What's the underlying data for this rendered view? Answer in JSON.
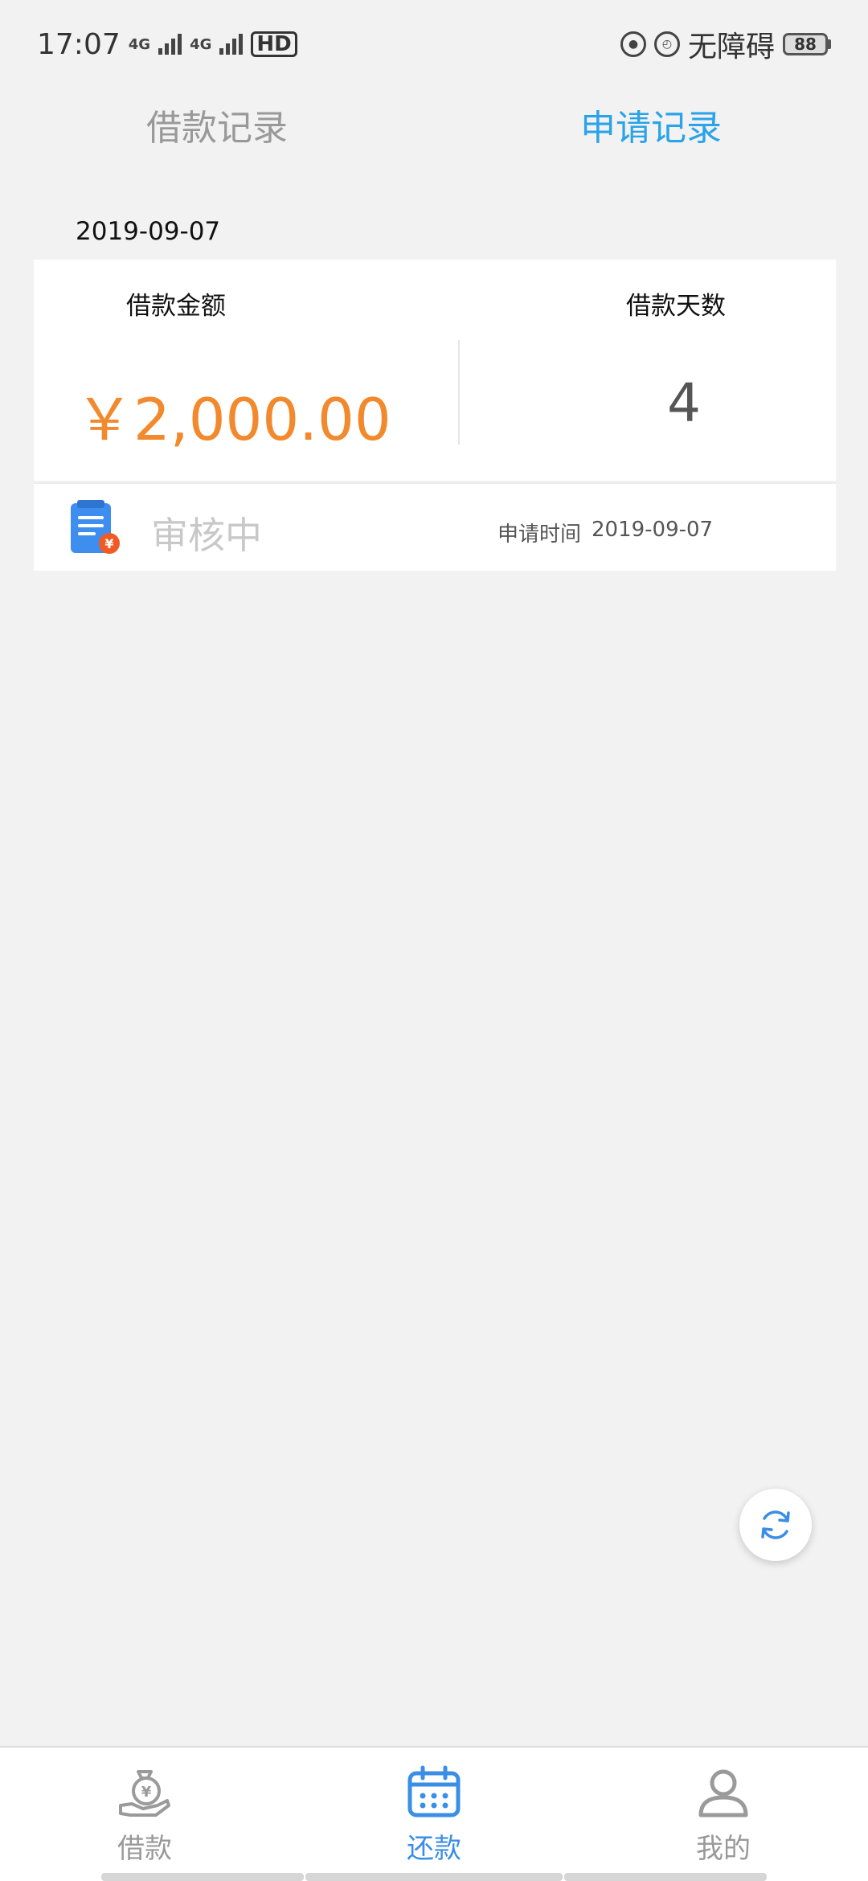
{
  "status_bar": {
    "time": "17:07",
    "net1": "4G",
    "net2": "4G",
    "hd": "HD",
    "accessibility": "无障碍",
    "battery": "88"
  },
  "tabs": [
    {
      "label": "借款记录",
      "active": false
    },
    {
      "label": "申请记录",
      "active": true
    }
  ],
  "record": {
    "date": "2019-09-07",
    "amount_label": "借款金额",
    "days_label": "借款天数",
    "amount": "￥2,000.00",
    "days": "4",
    "status": "审核中",
    "apply_time_label": "申请时间",
    "apply_time": "2019-09-07"
  },
  "bottom_nav": [
    {
      "label": "借款",
      "icon": "loan-bag-icon",
      "active": false
    },
    {
      "label": "还款",
      "icon": "calendar-icon",
      "active": true
    },
    {
      "label": "我的",
      "icon": "user-icon",
      "active": false
    }
  ],
  "colors": {
    "accent": "#2aa3e8",
    "amount": "#f2892c",
    "nav_active": "#3a8ee6"
  }
}
